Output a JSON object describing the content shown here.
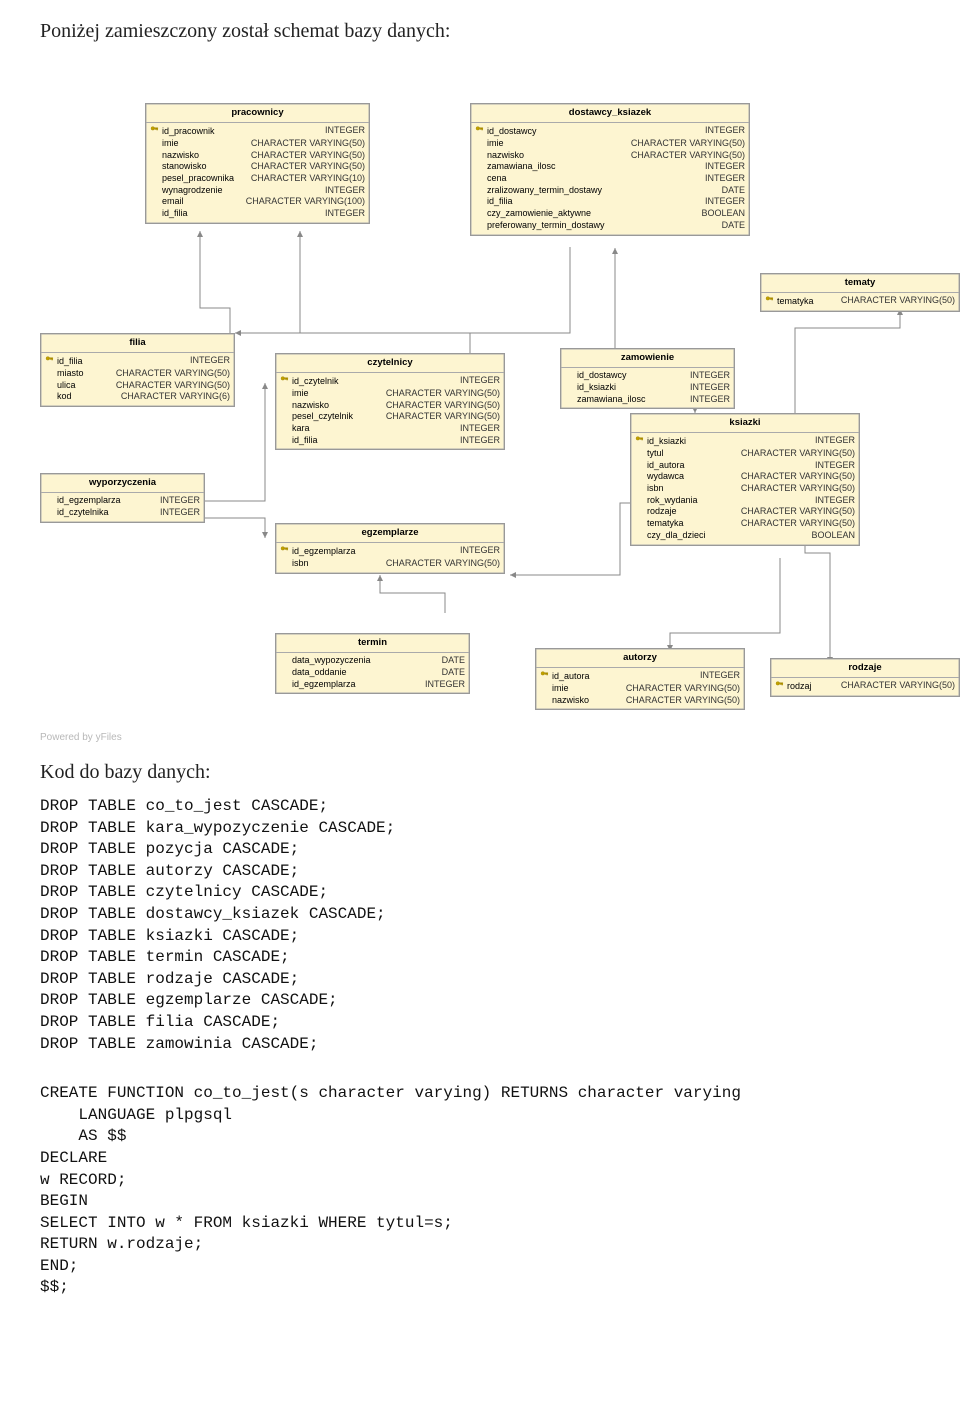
{
  "intro": "Poniżej zamieszczony został schemat bazy danych:",
  "poweredBy": "Powered by yFiles",
  "tables": {
    "pracownicy": {
      "title": "pracownicy",
      "rows": [
        {
          "key": true,
          "name": "id_pracownik",
          "type": "INTEGER"
        },
        {
          "key": false,
          "name": "imie",
          "type": "CHARACTER VARYING(50)"
        },
        {
          "key": false,
          "name": "nazwisko",
          "type": "CHARACTER VARYING(50)"
        },
        {
          "key": false,
          "name": "stanowisko",
          "type": "CHARACTER VARYING(50)"
        },
        {
          "key": false,
          "name": "pesel_pracownika",
          "type": "CHARACTER VARYING(10)"
        },
        {
          "key": false,
          "name": "wynagrodzenie",
          "type": "INTEGER"
        },
        {
          "key": false,
          "name": "email",
          "type": "CHARACTER VARYING(100)"
        },
        {
          "key": false,
          "name": "id_filia",
          "type": "INTEGER"
        }
      ]
    },
    "dostawcy_ksiazek": {
      "title": "dostawcy_ksiazek",
      "rows": [
        {
          "key": true,
          "name": "id_dostawcy",
          "type": "INTEGER"
        },
        {
          "key": false,
          "name": "imie",
          "type": "CHARACTER VARYING(50)"
        },
        {
          "key": false,
          "name": "nazwisko",
          "type": "CHARACTER VARYING(50)"
        },
        {
          "key": false,
          "name": "zamawiana_ilosc",
          "type": "INTEGER"
        },
        {
          "key": false,
          "name": "cena",
          "type": "INTEGER"
        },
        {
          "key": false,
          "name": "zralizowany_termin_dostawy",
          "type": "DATE"
        },
        {
          "key": false,
          "name": "id_filia",
          "type": "INTEGER"
        },
        {
          "key": false,
          "name": "czy_zamowienie_aktywne",
          "type": "BOOLEAN"
        },
        {
          "key": false,
          "name": "preferowany_termin_dostawy",
          "type": "DATE"
        }
      ]
    },
    "tematy": {
      "title": "tematy",
      "rows": [
        {
          "key": true,
          "name": "tematyka",
          "type": "CHARACTER VARYING(50)"
        }
      ]
    },
    "filia": {
      "title": "filia",
      "rows": [
        {
          "key": true,
          "name": "id_filia",
          "type": "INTEGER"
        },
        {
          "key": false,
          "name": "miasto",
          "type": "CHARACTER VARYING(50)"
        },
        {
          "key": false,
          "name": "ulica",
          "type": "CHARACTER VARYING(50)"
        },
        {
          "key": false,
          "name": "kod",
          "type": "CHARACTER VARYING(6)"
        }
      ]
    },
    "czytelnicy": {
      "title": "czytelnicy",
      "rows": [
        {
          "key": true,
          "name": "id_czytelnik",
          "type": "INTEGER"
        },
        {
          "key": false,
          "name": "imie",
          "type": "CHARACTER VARYING(50)"
        },
        {
          "key": false,
          "name": "nazwisko",
          "type": "CHARACTER VARYING(50)"
        },
        {
          "key": false,
          "name": "pesel_czytelnik",
          "type": "CHARACTER VARYING(50)"
        },
        {
          "key": false,
          "name": "kara",
          "type": "INTEGER"
        },
        {
          "key": false,
          "name": "id_filia",
          "type": "INTEGER"
        }
      ]
    },
    "zamowienie": {
      "title": "zamowienie",
      "rows": [
        {
          "key": false,
          "name": "id_dostawcy",
          "type": "INTEGER"
        },
        {
          "key": false,
          "name": "id_ksiazki",
          "type": "INTEGER"
        },
        {
          "key": false,
          "name": "zamawiana_ilosc",
          "type": "INTEGER"
        }
      ]
    },
    "wyporzyczenia": {
      "title": "wyporzyczenia",
      "rows": [
        {
          "key": false,
          "name": "id_egzemplarza",
          "type": "INTEGER"
        },
        {
          "key": false,
          "name": "id_czytelnika",
          "type": "INTEGER"
        }
      ]
    },
    "ksiazki": {
      "title": "ksiazki",
      "rows": [
        {
          "key": true,
          "name": "id_ksiazki",
          "type": "INTEGER"
        },
        {
          "key": false,
          "name": "tytul",
          "type": "CHARACTER VARYING(50)"
        },
        {
          "key": false,
          "name": "id_autora",
          "type": "INTEGER"
        },
        {
          "key": false,
          "name": "wydawca",
          "type": "CHARACTER VARYING(50)"
        },
        {
          "key": false,
          "name": "isbn",
          "type": "CHARACTER VARYING(50)"
        },
        {
          "key": false,
          "name": "rok_wydania",
          "type": "INTEGER"
        },
        {
          "key": false,
          "name": "rodzaje",
          "type": "CHARACTER VARYING(50)"
        },
        {
          "key": false,
          "name": "tematyka",
          "type": "CHARACTER VARYING(50)"
        },
        {
          "key": false,
          "name": "czy_dla_dzieci",
          "type": "BOOLEAN"
        }
      ]
    },
    "egzemplarze": {
      "title": "egzemplarze",
      "rows": [
        {
          "key": true,
          "name": "id_egzemplarza",
          "type": "INTEGER"
        },
        {
          "key": false,
          "name": "isbn",
          "type": "CHARACTER VARYING(50)"
        }
      ]
    },
    "termin": {
      "title": "termin",
      "rows": [
        {
          "key": false,
          "name": "data_wypozyczenia",
          "type": "DATE"
        },
        {
          "key": false,
          "name": "data_oddanie",
          "type": "DATE"
        },
        {
          "key": false,
          "name": "id_egzemplarza",
          "type": "INTEGER"
        }
      ]
    },
    "autorzy": {
      "title": "autorzy",
      "rows": [
        {
          "key": true,
          "name": "id_autora",
          "type": "INTEGER"
        },
        {
          "key": false,
          "name": "imie",
          "type": "CHARACTER VARYING(50)"
        },
        {
          "key": false,
          "name": "nazwisko",
          "type": "CHARACTER VARYING(50)"
        }
      ]
    },
    "rodzaje": {
      "title": "rodzaje",
      "rows": [
        {
          "key": true,
          "name": "rodzaj",
          "type": "CHARACTER VARYING(50)"
        }
      ]
    }
  },
  "subhead": "Kod do bazy danych:",
  "codeDrops": [
    "DROP TABLE co_to_jest CASCADE;",
    "DROP TABLE kara_wypozyczenie CASCADE;",
    "DROP TABLE pozycja CASCADE;",
    "DROP TABLE autorzy CASCADE;",
    "DROP TABLE czytelnicy CASCADE;",
    "DROP TABLE dostawcy_ksiazek CASCADE;",
    "DROP TABLE ksiazki CASCADE;",
    "DROP TABLE termin CASCADE;",
    "DROP TABLE rodzaje CASCADE;",
    "DROP TABLE egzemplarze CASCADE;",
    "DROP TABLE filia CASCADE;",
    "DROP TABLE zamowinia CASCADE;"
  ],
  "codeFunc": [
    "CREATE FUNCTION co_to_jest(s character varying) RETURNS character varying",
    "    LANGUAGE plpgsql",
    "    AS $$",
    "DECLARE",
    "w RECORD;",
    "BEGIN",
    "SELECT INTO w * FROM ksiazki WHERE tytul=s;",
    "RETURN w.rodzaje;",
    "END;",
    "$$;"
  ]
}
